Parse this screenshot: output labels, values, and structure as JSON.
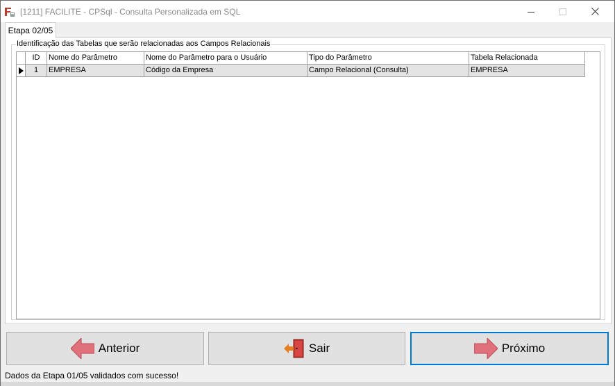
{
  "window": {
    "title": "[1211] FACILITE - CPSql - Consulta Personalizada em SQL",
    "icons": [
      "app-icon",
      "minimize-icon",
      "maximize-icon",
      "close-icon"
    ]
  },
  "tab": {
    "label": "Etapa 02/05"
  },
  "group": {
    "legend": "Identificação das Tabelas que serão relacionadas aos Campos Relacionais"
  },
  "grid": {
    "columns": [
      "ID",
      "Nome do Parâmetro",
      "Nome do Parâmetro para o Usuário",
      "Tipo do Parâmetro",
      "Tabela Relacionada"
    ],
    "rows": [
      {
        "id": "1",
        "nome": "EMPRESA",
        "usuario": "Código da Empresa",
        "tipo": "Campo Relacional (Consulta)",
        "tabela": "EMPRESA"
      }
    ]
  },
  "buttons": {
    "anterior": "Anterior",
    "sair": "Sair",
    "proximo": "Próximo"
  },
  "colors": {
    "accent": "#0078d7",
    "arrow": "#e0707a",
    "door": "#d94545"
  },
  "status": {
    "text": "Dados da Etapa 01/05 validados com sucesso!"
  }
}
